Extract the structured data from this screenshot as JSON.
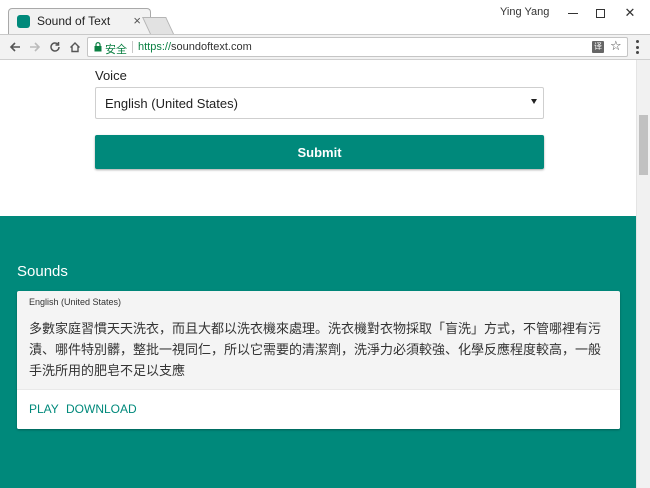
{
  "browser": {
    "tab_title": "Sound of Text",
    "tab_close": "×",
    "profile_name": "Ying Yang",
    "secure_label": "安全",
    "url_scheme": "https://",
    "url_host": "soundoftext.com",
    "translate_icon": "译",
    "star_icon": "☆",
    "window_close": "✕"
  },
  "form": {
    "voice_label": "Voice",
    "voice_value": "English (United States)",
    "submit_label": "Submit"
  },
  "sounds": {
    "title": "Sounds",
    "cards": [
      {
        "language": "English (United States)",
        "text": "多數家庭習慣天天洗衣，而且大都以洗衣機來處理。洗衣機對衣物採取「盲洗」方式，不管哪裡有污漬、哪件特別髒，整批一視同仁，所以它需要的清潔劑，洗淨力必須較強、化學反應程度較高，一般手洗所用的肥皂不足以支應",
        "play_label": "PLAY",
        "download_label": "DOWNLOAD"
      }
    ]
  },
  "colors": {
    "accent": "#00897b",
    "secure_green": "#0b8043",
    "card_bg": "#f4f4f4"
  }
}
